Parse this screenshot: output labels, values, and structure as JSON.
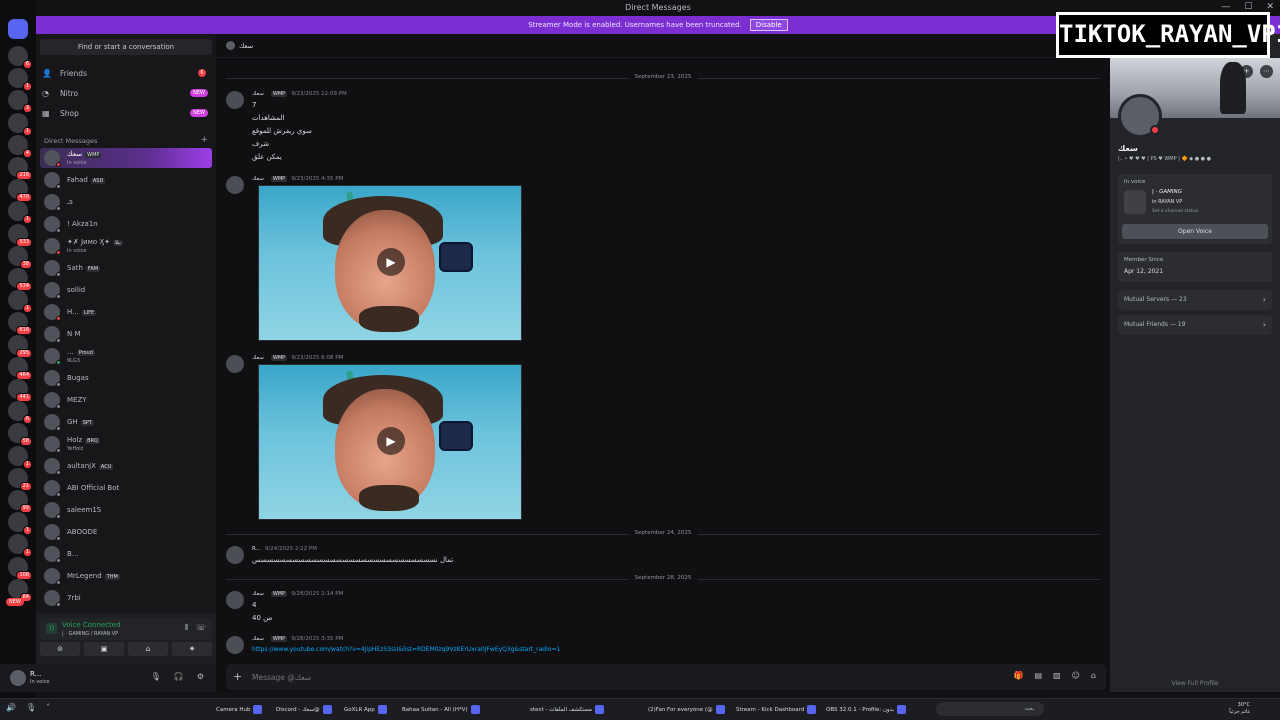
{
  "window": {
    "title": "Direct Messages",
    "controls": [
      "—",
      "☐",
      "✕"
    ]
  },
  "streamer_banner": {
    "text": "Streamer Mode is enabled. Usernames have been truncated.",
    "button": "Disable"
  },
  "watermark": "TIKTOK_RAYAN_VP1",
  "server_rail": {
    "badges": [
      "6",
      "1",
      "3",
      "1",
      "4",
      "216",
      "470",
      "1",
      "533",
      "38",
      "534",
      "1",
      "616",
      "295",
      "464",
      "441",
      "6",
      "58",
      "1",
      "21",
      "99",
      "1",
      "1",
      "108",
      "84"
    ],
    "new_label": "NEW"
  },
  "sidebar": {
    "find_placeholder": "Find or start a conversation",
    "nav": [
      {
        "label": "Friends",
        "icon": "friends-icon",
        "count": "6"
      },
      {
        "label": "Nitro",
        "icon": "nitro-icon",
        "pill": "NEW"
      },
      {
        "label": "Shop",
        "icon": "shop-icon",
        "pill": "NEW"
      }
    ],
    "dm_header": "Direct Messages",
    "dm_header_add": "+",
    "dms": [
      {
        "name": "سعك",
        "tag": "WMP",
        "sub": "In voice",
        "active": true,
        "status": "dnd"
      },
      {
        "name": "Fahad",
        "tag": "ASD",
        "sub": "",
        "status": "off"
      },
      {
        "name": "ـs",
        "tag": "",
        "sub": "",
        "status": "off"
      },
      {
        "name": "! Akza1n",
        "tag": "",
        "sub": "",
        "status": "off"
      },
      {
        "name": "✦✗ Jимо Ӽ✦",
        "tag": "بيلا",
        "sub": "In voice",
        "status": "dnd"
      },
      {
        "name": "Sath",
        "tag": "FAM",
        "sub": "",
        "status": "off"
      },
      {
        "name": "sollid",
        "tag": "",
        "sub": "",
        "status": "off"
      },
      {
        "name": "H...",
        "tag": "LIFE",
        "sub": "",
        "status": "dnd"
      },
      {
        "name": "N M",
        "tag": "",
        "sub": "",
        "status": "off"
      },
      {
        "name": "...",
        "tag": "Proud",
        "sub": "9LG3",
        "status": "on"
      },
      {
        "name": "Bugas",
        "tag": "",
        "sub": "",
        "status": "off"
      },
      {
        "name": "MEZY",
        "tag": "",
        "sub": "",
        "status": "off"
      },
      {
        "name": "GH",
        "tag": "SPT",
        "sub": "",
        "status": "off"
      },
      {
        "name": "Holz",
        "tag": "BRQ",
        "sub": "YeHolz",
        "status": "off"
      },
      {
        "name": "aultanjX",
        "tag": "ACU",
        "sub": "",
        "status": "off"
      },
      {
        "name": "ABI Official Bot",
        "tag": "",
        "sub": "",
        "status": "off"
      },
      {
        "name": "saleem1S",
        "tag": "",
        "sub": "",
        "status": "off"
      },
      {
        "name": "ABOODE",
        "tag": "",
        "sub": "",
        "status": "off"
      },
      {
        "name": "B...",
        "tag": "",
        "sub": "",
        "status": "off"
      },
      {
        "name": "MrLegend",
        "tag": "THM",
        "sub": "",
        "status": "off"
      },
      {
        "name": "7rbi",
        "tag": "",
        "sub": "",
        "status": "off"
      }
    ]
  },
  "voice_panel": {
    "status": "Voice Connected",
    "channel": "| · GAMING / RAYAN VP"
  },
  "user_panel": {
    "name": "R...",
    "sub": "In voice"
  },
  "chat": {
    "header_name": "سعك",
    "dividers": [
      "September 23, 2025",
      "September 24, 2025",
      "September 28, 2025"
    ],
    "messages": [
      {
        "author": "سعك",
        "tag": "WMP",
        "time": "9/23/2025 12:09 PM",
        "lines": [
          "7",
          "المشاهدات",
          "سوي ريفرش للموقع",
          "شرف",
          "يمكن علق"
        ]
      },
      {
        "author": "سعك",
        "tag": "WMP",
        "time": "9/23/2025 4:35 PM",
        "lines": []
      },
      {
        "author": "سعك",
        "tag": "WMP",
        "time": "9/23/2025 6:08 PM",
        "lines": []
      },
      {
        "author": "R...",
        "tag": "",
        "time": "9/24/2025 2:22 PM",
        "lines": [
          "تمال نسسسسسسسسسسسسسسسسسسسسسسسسسسسسس"
        ]
      },
      {
        "author": "سعك",
        "tag": "WMP",
        "time": "9/28/2025 2:14 PM",
        "lines": [
          "4",
          "من 40"
        ]
      },
      {
        "author": "سعك",
        "tag": "WMP",
        "time": "9/28/2025 3:35 PM",
        "link": "https://www.youtube.com/watch?v=4JipHEzS3sU&list=RDEM0zq9VzKErUxra0JFwEyQ3g&start_radio=1"
      }
    ],
    "composer_placeholder": "Message @سعك"
  },
  "profile": {
    "name": "سعك",
    "badges_text": "|.. • ♥ ♥ ♥ | PS ♥ WMP | 🔶 ◆ ● ● ●",
    "in_voice_label": "In voice",
    "voice_channel": "| · GAMING",
    "voice_server": "in RAYAN VP",
    "voice_status": "Set a channel status",
    "open_voice": "Open Voice",
    "member_since_label": "Member Since",
    "member_since": "Apr 12, 2021",
    "mutual_servers": "Mutual Servers — 23",
    "mutual_friends": "Mutual Friends — 19",
    "view_full": "View Full Profile"
  },
  "taskbar": {
    "items": [
      {
        "label": "Camera Hub"
      },
      {
        "label": "Discord - سعك@"
      },
      {
        "label": "GoXLR App"
      },
      {
        "label": "Bahaa Sultan - All (H*V)"
      },
      {
        "label": "stext - مستكشف الملفات"
      },
      {
        "label": "(2)Fan For everyone (@"
      },
      {
        "label": "Stream - Kick Dashboard"
      },
      {
        "label": "OBS 32.0.1 - Profile: بدون"
      }
    ],
    "search_placeholder": "بحث",
    "clock_line1": "30°C",
    "clock_line2": "غائم جزئياً"
  },
  "colors": {
    "accent": "#7b2fd3",
    "online": "#23a55a",
    "dnd": "#f23f43",
    "link": "#00a8fc"
  }
}
